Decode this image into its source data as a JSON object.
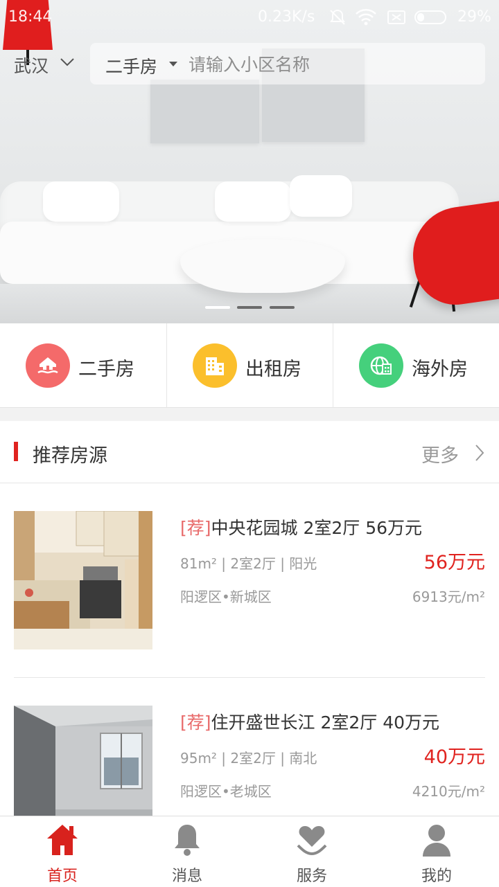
{
  "status_bar": {
    "time": "18:44",
    "net_speed": "0.23K/s",
    "battery": "29%",
    "icons": [
      "mute-icon",
      "wifi-icon",
      "sim-icon",
      "battery-icon"
    ]
  },
  "search": {
    "city": "武汉",
    "type": "二手房",
    "placeholder": "请输入小区名称"
  },
  "banner": {
    "slide_count": 3,
    "active_slide": 1,
    "dot_active_color": "#ffffff",
    "dot_inactive_color": "#6b6b6b"
  },
  "categories": [
    {
      "label": "二手房",
      "icon": "house-hand-icon",
      "color": "#f46a6a"
    },
    {
      "label": "出租房",
      "icon": "building-icon",
      "color": "#fbbf2c"
    },
    {
      "label": "海外房",
      "icon": "globe-building-icon",
      "color": "#45d07c"
    }
  ],
  "recommend": {
    "title": "推荐房源",
    "more": "更多",
    "accent_color": "#e0231f",
    "listings": [
      {
        "tag": "[荐]",
        "title": "中央花园城 2室2厅 56万元",
        "meta": "81m² | 2室2厅 | 阳光",
        "price": "56万元",
        "area": "阳逻区•新城区",
        "unit_price": "6913元/m²"
      },
      {
        "tag": "[荐]",
        "title": "住开盛世长江 2室2厅 40万元",
        "meta": "95m² | 2室2厅 | 南北",
        "price": "40万元",
        "area": "阳逻区•老城区",
        "unit_price": "4210元/m²"
      }
    ]
  },
  "tabbar": {
    "active_color": "#d8221d",
    "tabs": [
      {
        "label": "首页",
        "icon": "home-icon"
      },
      {
        "label": "消息",
        "icon": "bell-icon"
      },
      {
        "label": "服务",
        "icon": "heart-hand-icon"
      },
      {
        "label": "我的",
        "icon": "user-icon"
      }
    ]
  }
}
